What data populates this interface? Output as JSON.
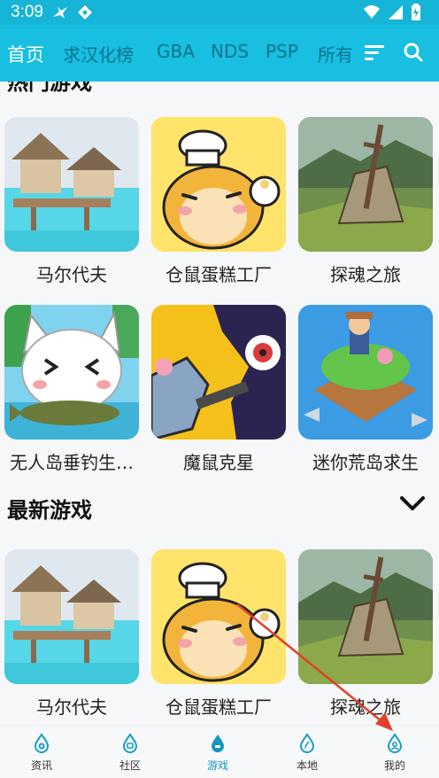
{
  "status_bar": {
    "time": "3:09",
    "left_icons": [
      "bird-icon",
      "diamond-icon"
    ],
    "right_icons": [
      "wifi-icon",
      "signal-icon",
      "battery-icon"
    ]
  },
  "top_tabs": [
    {
      "label": "首页",
      "active": true
    },
    {
      "label": "求汉化榜",
      "active": false
    },
    {
      "label": "GBA",
      "active": false
    },
    {
      "label": "NDS",
      "active": false
    },
    {
      "label": "PSP",
      "active": false
    },
    {
      "label": "所有",
      "active": false
    }
  ],
  "top_actions": [
    "sort-icon",
    "search-icon"
  ],
  "sections": {
    "hot": {
      "title": "热门游戏",
      "games": [
        {
          "name": "马尔代夫",
          "art": "maldives-art"
        },
        {
          "name": "仓鼠蛋糕工厂",
          "art": "hamster-chef-art"
        },
        {
          "name": "探魂之旅",
          "art": "sword-rock-art"
        },
        {
          "name": "无人岛垂钓生…",
          "art": "cat-fishing-art"
        },
        {
          "name": "魔鼠克星",
          "art": "rat-monster-art"
        },
        {
          "name": "迷你荒岛求生",
          "art": "island-survival-art"
        }
      ]
    },
    "latest": {
      "title": "最新游戏",
      "expand_icon": "chevron-down-icon",
      "games": [
        {
          "name": "马尔代夫",
          "art": "maldives-art"
        },
        {
          "name": "仓鼠蛋糕工厂",
          "art": "hamster-chef-art"
        },
        {
          "name": "探魂之旅",
          "art": "sword-rock-art"
        }
      ]
    }
  },
  "bottom_nav": [
    {
      "label": "资讯",
      "icon": "news-icon",
      "active": false
    },
    {
      "label": "社区",
      "icon": "community-icon",
      "active": false
    },
    {
      "label": "游戏",
      "icon": "game-icon",
      "active": true
    },
    {
      "label": "本地",
      "icon": "local-icon",
      "active": false
    },
    {
      "label": "我的",
      "icon": "profile-icon",
      "active": false
    }
  ],
  "colors": {
    "header": "#18bfe0",
    "status": "#16b4d6",
    "accent": "#1497bf",
    "annotation_arrow": "#e0412b"
  }
}
